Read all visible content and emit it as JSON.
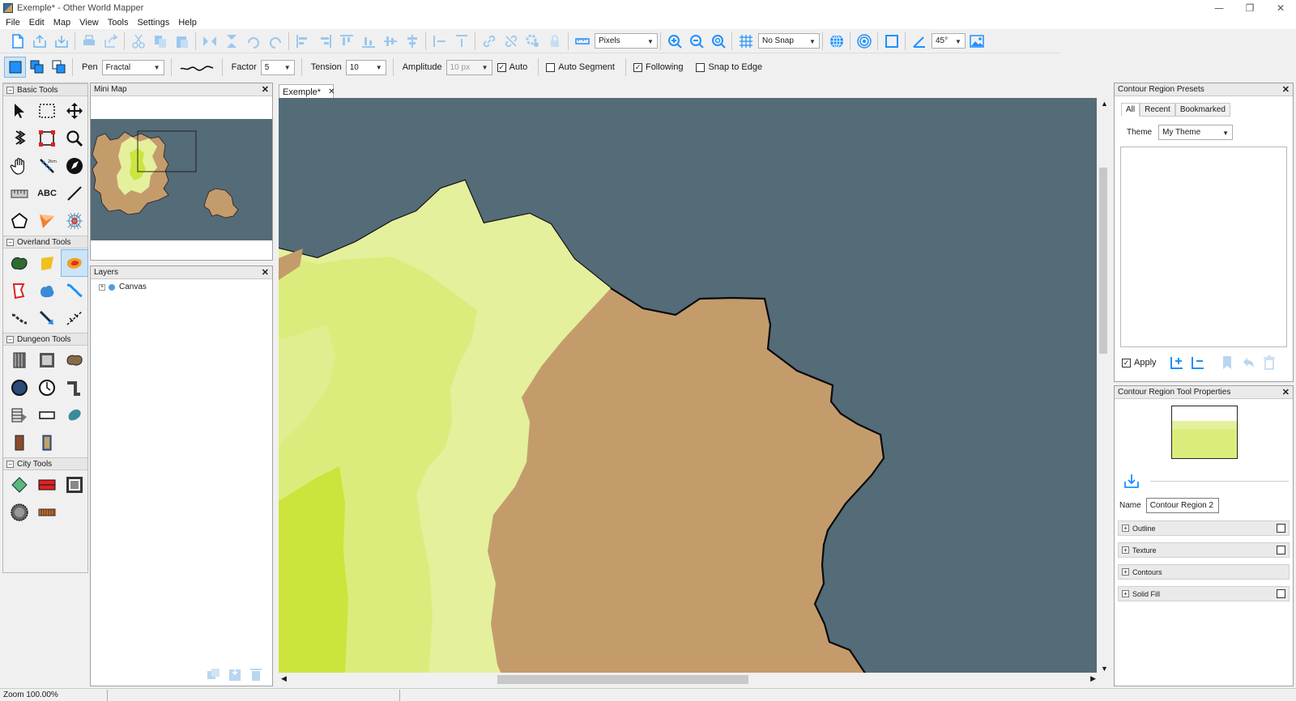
{
  "window": {
    "title": "Exemple* - Other World Mapper",
    "minimize": "—",
    "restore": "❐",
    "close": "✕"
  },
  "menu": [
    "File",
    "Edit",
    "Map",
    "View",
    "Tools",
    "Settings",
    "Help"
  ],
  "toolbar": {
    "units_value": "Pixels",
    "snap_value": "No Snap",
    "angle_value": "45°"
  },
  "pen_toolbar": {
    "pen_label": "Pen",
    "pen_value": "Fractal",
    "factor_label": "Factor",
    "factor_value": "5",
    "tension_label": "Tension",
    "tension_value": "10",
    "amplitude_label": "Amplitude",
    "amplitude_value": "10 px",
    "auto_label": "Auto",
    "auto_checked": true,
    "auto_segment_label": "Auto Segment",
    "auto_segment_checked": false,
    "following_label": "Following",
    "following_checked": true,
    "snap_edge_label": "Snap to Edge",
    "snap_edge_checked": false
  },
  "toolbox": {
    "groups": [
      {
        "title": "Basic Tools"
      },
      {
        "title": "Overland Tools"
      },
      {
        "title": "Dungeon Tools"
      },
      {
        "title": "City Tools"
      }
    ],
    "text_tool_label": "ABC"
  },
  "minimap": {
    "title": "Mini Map"
  },
  "layers": {
    "title": "Layers",
    "items": [
      "Canvas"
    ]
  },
  "document": {
    "tab_label": "Exemple*"
  },
  "presets": {
    "title": "Contour Region Presets",
    "tabs": [
      "All",
      "Recent",
      "Bookmarked"
    ],
    "theme_label": "Theme",
    "theme_value": "My Theme",
    "apply_label": "Apply",
    "apply_checked": true
  },
  "properties": {
    "title": "Contour Region Tool Properties",
    "name_label": "Name",
    "name_value": "Contour Region 2",
    "sections": [
      "Outline",
      "Texture",
      "Contours",
      "Solid Fill"
    ]
  },
  "status": {
    "zoom": "Zoom 100.00%"
  },
  "colors": {
    "water": "#546b78",
    "land_brown": "#c49c6c",
    "contour_light": "#e4f09c",
    "contour_mid": "#dcec7c",
    "contour_dark": "#cde43c",
    "accent_blue": "#1e90ff"
  }
}
